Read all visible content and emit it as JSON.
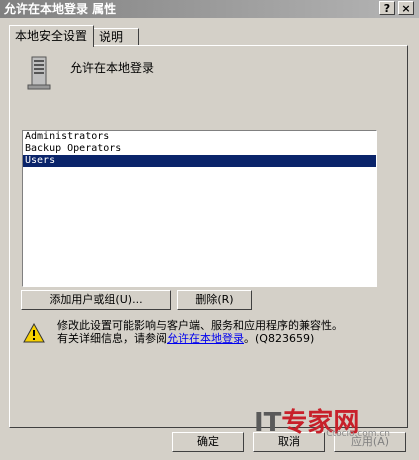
{
  "window": {
    "title": "允许在本地登录 属性",
    "help_glyph": "?",
    "close_glyph": "×"
  },
  "tabs": [
    {
      "label": "本地安全设置",
      "active": true
    },
    {
      "label": "说明",
      "active": false
    }
  ],
  "policy": {
    "name": "允许在本地登录",
    "icon": "server-icon"
  },
  "members": [
    {
      "name": "Administrators",
      "selected": false
    },
    {
      "name": "Backup Operators",
      "selected": false
    },
    {
      "name": "Users",
      "selected": true
    }
  ],
  "buttons": {
    "add": "添加用户或组(U)...",
    "remove": "删除(R)",
    "ok": "确定",
    "cancel": "取消",
    "apply": "应用(A)"
  },
  "warning": {
    "icon": "warning-icon",
    "line1": "修改此设置可能影响与客户端、服务和应用程序的兼容性。",
    "line2_prefix": "有关详细信息，请参阅",
    "link": "允许在本地登录",
    "line2_suffix": "。(Q823659)"
  },
  "watermark": {
    "logo_it": "IT",
    "logo_text": "专家网",
    "url": "Ctocio.com.cn"
  }
}
